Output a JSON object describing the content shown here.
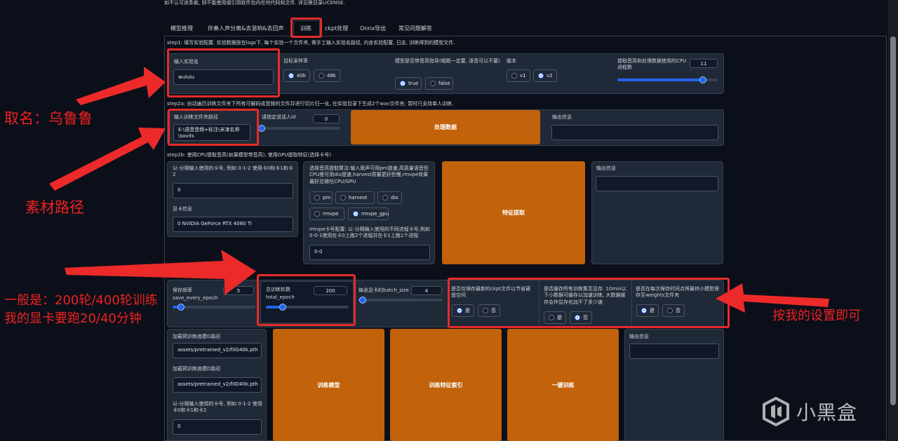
{
  "header_note": "如不认可该条款, 则不能使用或引用软件包内任何代码和文件. 详见根目录LICENSE.",
  "tabs": [
    "模型推理",
    "伴奏人声分离&去混响&去回声",
    "训练",
    "ckpt处理",
    "Onnx导出",
    "常见问题解答"
  ],
  "active_tab": "训练",
  "step1": {
    "desc": "step1: 填写实验配置. 实验数据放在logs下, 每个实验一个文件夹, 需手工输入实验名路径, 内含实验配置, 日志, 训练得到的模型文件.",
    "exp_name_label": "输入实验名",
    "exp_name_value": "wululu",
    "sr_label": "目标采样率",
    "sr_options": [
      "40k",
      "48k"
    ],
    "sr_selected": "40k",
    "pitch_label": "模型是否带音高指导(唱歌一定要, 语音可以不要)",
    "pitch_options": [
      "true",
      "false"
    ],
    "pitch_selected": "true",
    "version_label": "版本",
    "version_options": [
      "v1",
      "v2"
    ],
    "version_selected": "v2",
    "cpu_label": "提取音高和处理数据使用的CPU进程数",
    "cpu_value": "11",
    "cpu_fraction": 0.85
  },
  "step2a": {
    "desc": "step2a: 自动遍历训练文件夹下所有可解码成音频的文件并进行切片归一化, 在实验目录下生成2个wav文件夹; 暂时只支持单人训练.",
    "path_label": "输入训练文件夹路径",
    "path_value": "E:\\语音音频+标注\\米津玄师\\sovits",
    "speaker_label": "请指定说话人id",
    "speaker_value": "0",
    "speaker_fraction": 0.0,
    "process_button": "处理数据",
    "output_label": "输出信息"
  },
  "step2b": {
    "desc": "step2b: 使用CPU提取音高(如果模型带音高), 使用GPU提取特征(选择卡号)",
    "gpus_label": "以-分隔输入使用的卡号, 例如 0-1-2 使用卡0和卡1和卡2",
    "gpus_value": "0",
    "gpu_info_label": "显卡信息",
    "gpu_info_value": "0 NVIDIA GeForce RTX 4060 Ti",
    "f0_label": "选择音高提取算法:输入歌声可用pm提速,高质量语音但CPU差可用dio提速,harvest质量更好但慢,rmvpe效果最好且微吃CPU/GPU",
    "f0_options": [
      "pm",
      "harvest",
      "dio",
      "rmvpe",
      "rmvpe_gpu"
    ],
    "f0_selected": "rmvpe_gpu",
    "rmvpe_label": "rmvpe卡号配置: 以-分隔输入使用的不同进程卡号,例如0-0-1使用在卡0上跑2个进程并在卡1上跑1个进程",
    "rmvpe_value": "0-0",
    "extract_button": "特征提取",
    "output_label": "输出信息"
  },
  "step3": {
    "save_every_label": "保存频率save_every_epoch",
    "save_every_value": "5",
    "save_every_fraction": 0.1,
    "epoch_label": "总训练轮数total_epoch",
    "epoch_value": "200",
    "epoch_fraction": 0.2,
    "batch_label": "每张显卡的batch_size",
    "batch_value": "4",
    "batch_fraction": 0.05,
    "latest_label": "是否仅保存最新的ckpt文件以节省硬盘空间",
    "latest_options": [
      "是",
      "否"
    ],
    "latest_selected": "是",
    "cache_label": "是否缓存所有训练集至显存. 10min以下小数据可缓存以加速训练, 大数据缓存会炸显存也加不了多少速",
    "cache_options": [
      "是",
      "否"
    ],
    "cache_selected": "否",
    "weights_label": "是否在每次保存时间点将最终小模型保存至weights文件夹",
    "weights_options": [
      "是",
      "否"
    ],
    "weights_selected": "是",
    "pretrained_g_label": "加载预训练底模G路径",
    "pretrained_g_value": "assets/pretrained_v2/f0G40k.pth",
    "pretrained_d_label": "加载预训练底模D路径",
    "pretrained_d_value": "assets/pretrained_v2/f0D40k.pth",
    "gpus_label": "以-分隔输入使用的卡号, 例如 0-1-2 使用卡0和卡1和卡2",
    "gpus_value": "0",
    "train_model_button": "训练模型",
    "train_index_button": "训练特征索引",
    "one_click_button": "一键训练",
    "output_label": "输出信息"
  },
  "annotations": {
    "naming": "取名：乌鲁鲁",
    "material_path": "素材路径",
    "epochs_line1": "一般是：200轮/400轮训练",
    "epochs_line2": "我的显卡要跑20/40分钟",
    "my_settings": "按我的设置即可"
  },
  "watermark": "小黑盒",
  "colors": {
    "accent_orange": "#c2620a",
    "annotation_red": "#e52b2b",
    "selected_blue": "#2563eb"
  }
}
